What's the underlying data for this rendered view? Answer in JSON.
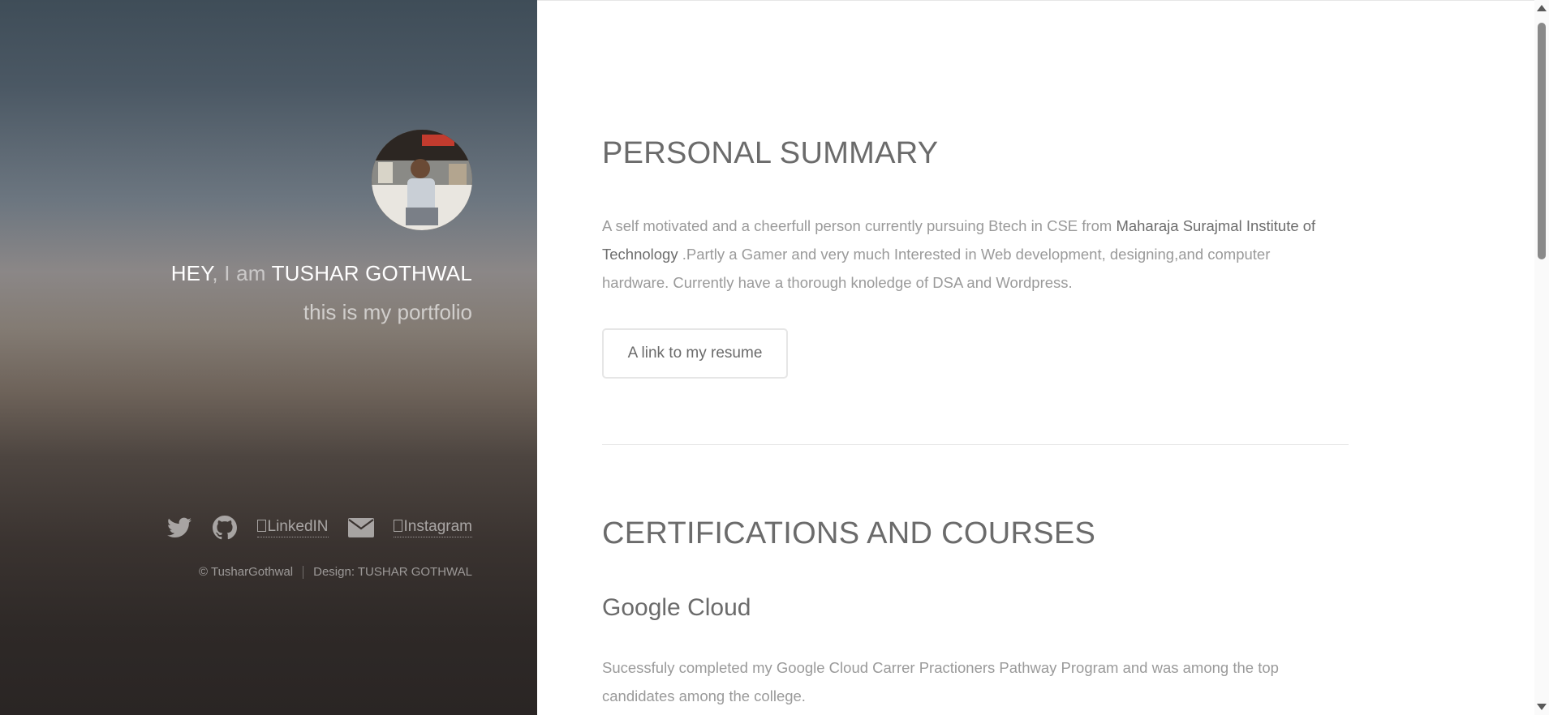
{
  "header": {
    "greeting": "HEY",
    "intro": ", I am ",
    "name": "TUSHAR GOTHWAL",
    "tagline": "this is my portfolio",
    "links": {
      "linkedin": "LinkedIN",
      "instagram": "Instagram"
    },
    "copyright": "© TusharGothwal",
    "design": "Design: TUSHAR GOTHWAL"
  },
  "main": {
    "summary": {
      "title": "PERSONAL SUMMARY",
      "text_before": "A self motivated and a cheerfull person currently pursuing Btech in CSE from ",
      "college": "Maharaja Surajmal Institute of Technology",
      "text_after": " .Partly a Gamer and very much Interested in Web development, designing,and computer hardware. Currently have a thorough knoledge of DSA and Wordpress.",
      "resume_button": "A link to my resume"
    },
    "certs": {
      "title": "CERTIFICATIONS AND COURSES",
      "items": [
        {
          "name": "Google Cloud",
          "description": "Sucessfuly completed my Google Cloud Carrer Practioners Pathway Program and was among the top candidates among the college."
        }
      ]
    }
  },
  "icons": [
    "twitter-icon",
    "github-icon",
    "envelope-icon"
  ]
}
